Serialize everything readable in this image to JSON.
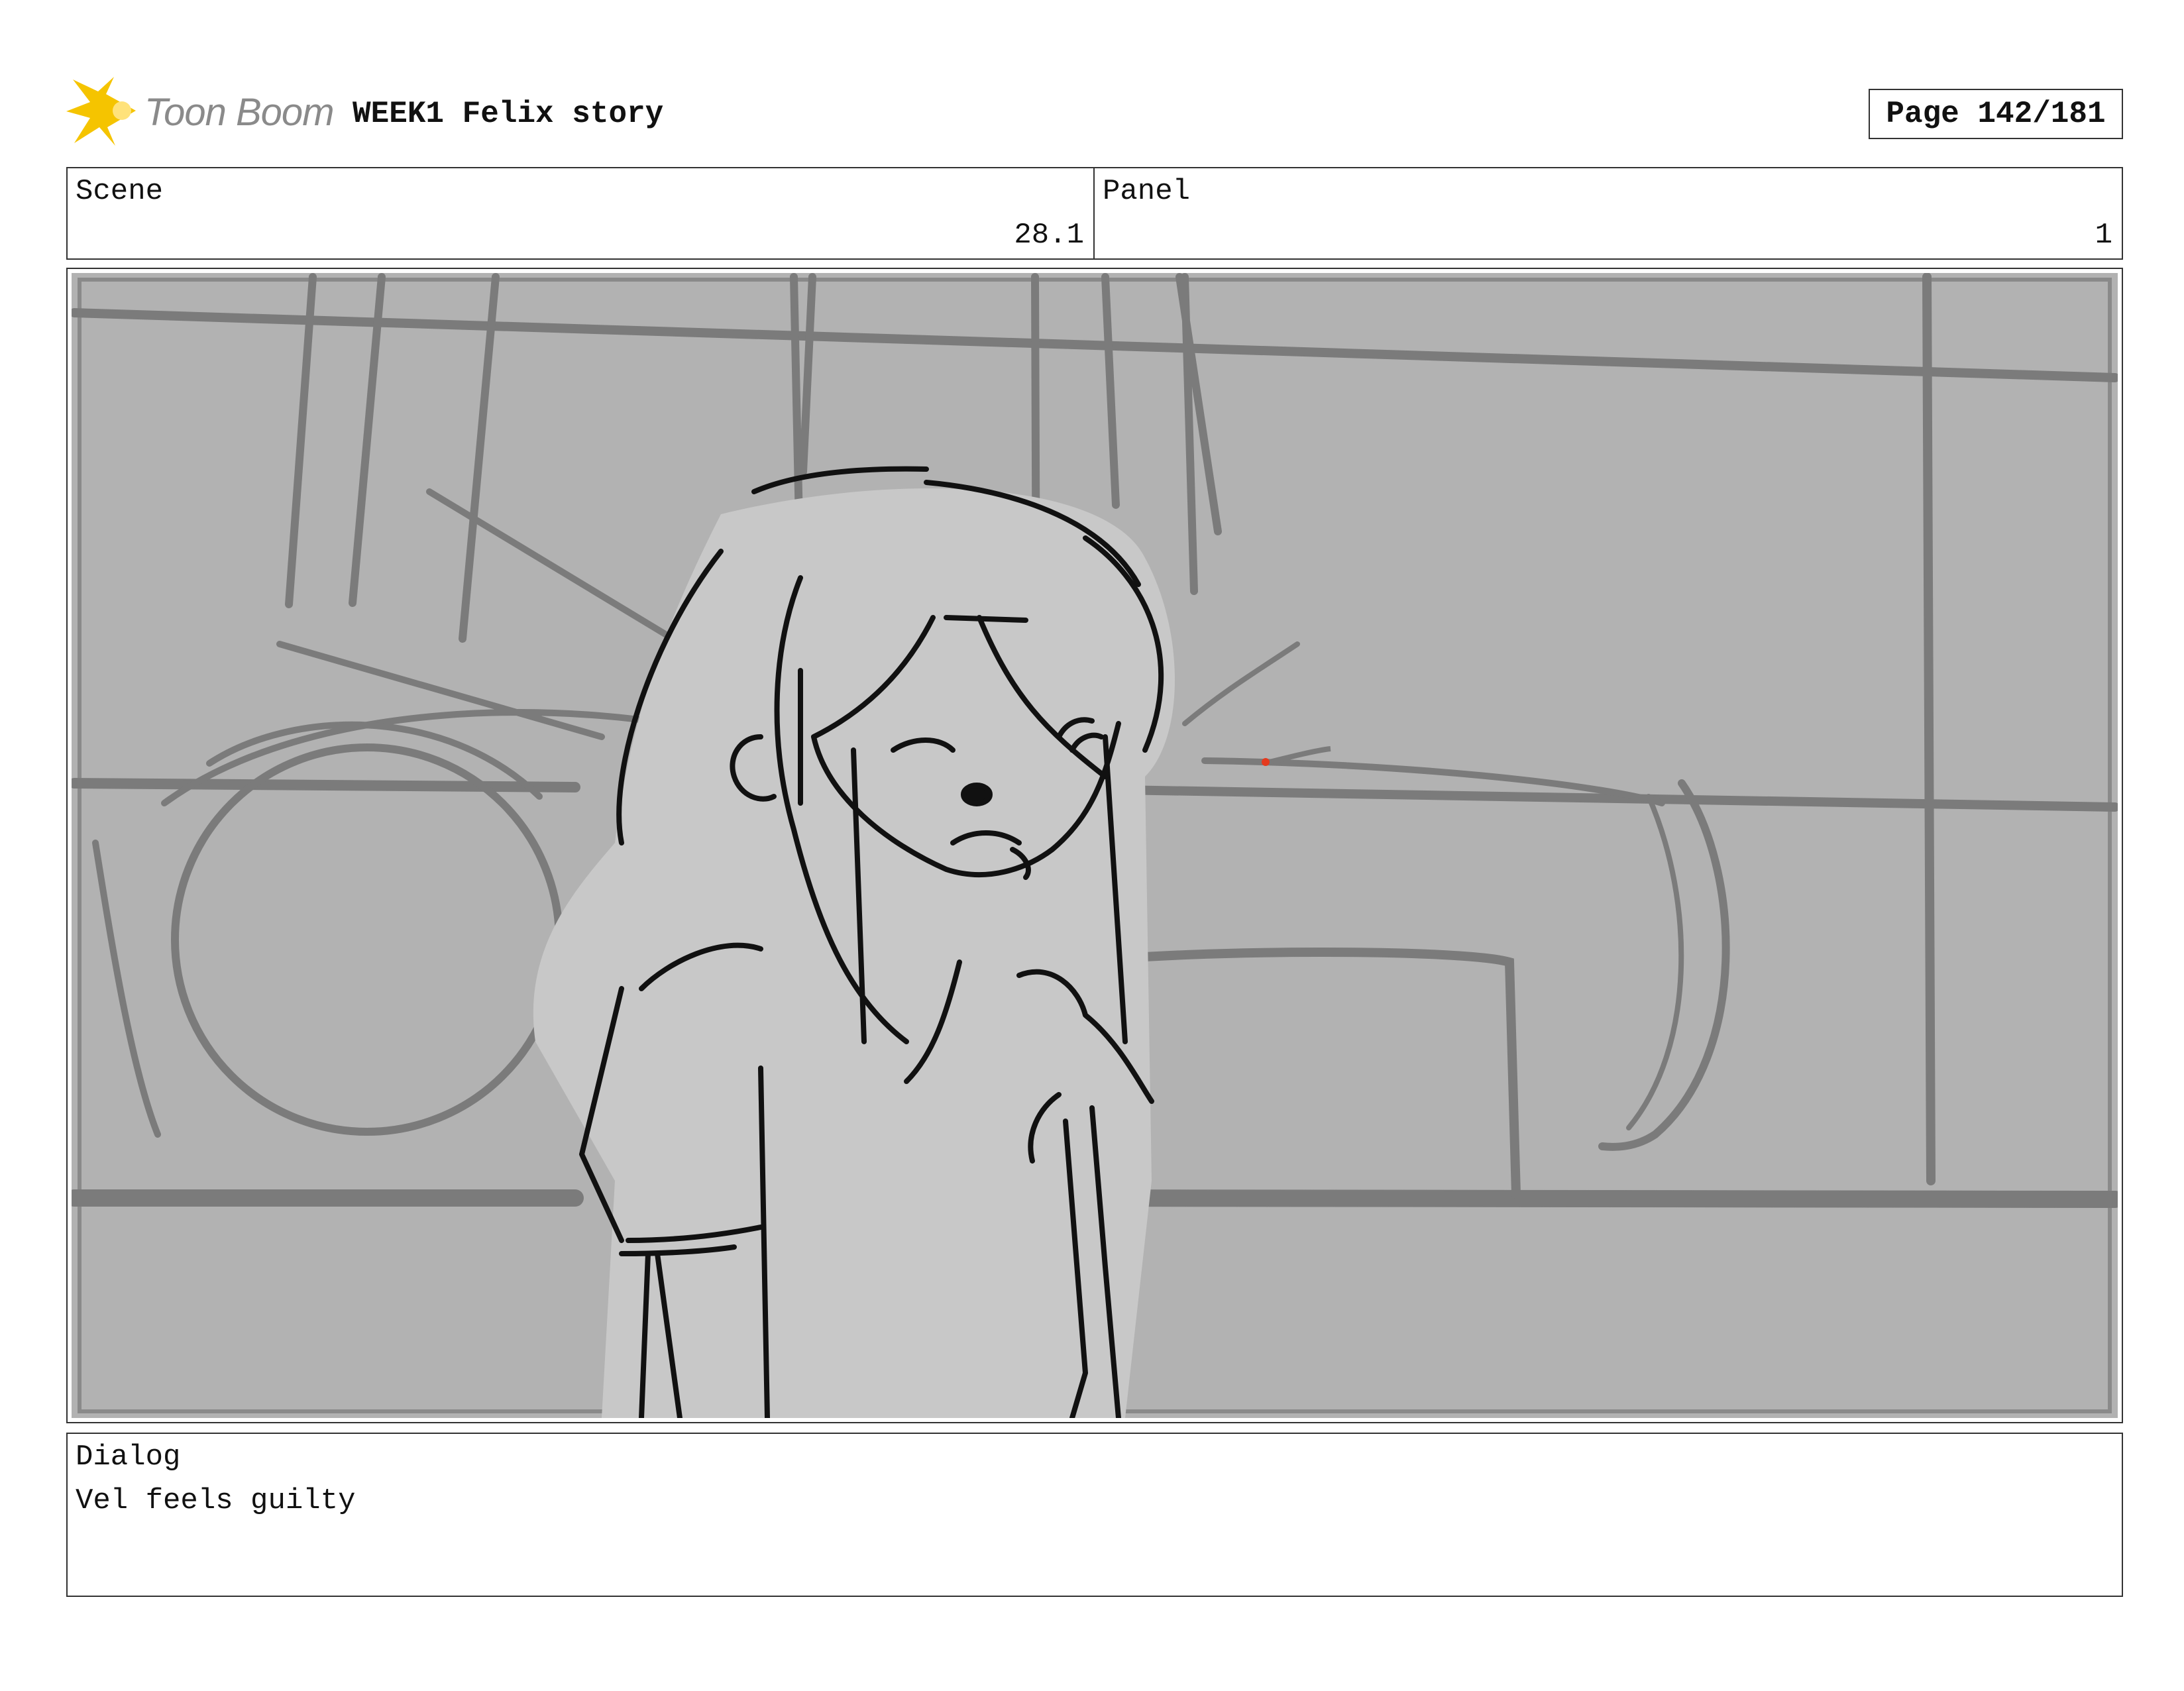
{
  "header": {
    "logo_text": "Toon Boom",
    "project_title": "WEEK1 Felix story",
    "page_label": "Page 142/181"
  },
  "scene": {
    "label": "Scene",
    "value": "28.1"
  },
  "panel": {
    "label": "Panel",
    "value": "1"
  },
  "dialog": {
    "label": "Dialog",
    "text": "Vel feels guilty"
  },
  "colors": {
    "logo_yellow": "#f5c400",
    "background_gray": "#b2b2b2",
    "structure_gray": "#7b7b7b",
    "figure_fill": "#c8c8c8",
    "line_black": "#111111",
    "accent_red": "#e53a1e"
  }
}
